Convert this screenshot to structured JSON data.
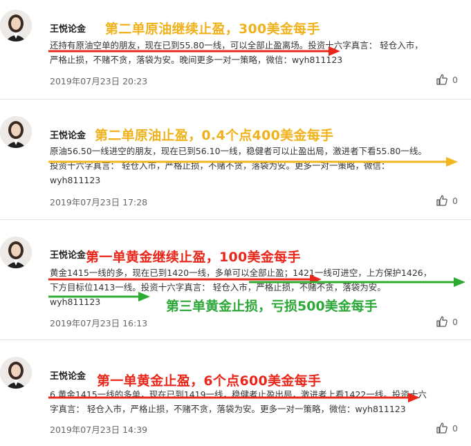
{
  "colors": {
    "yellow_headline": "#f0b21c",
    "red_headline": "#e8261a",
    "green_headline": "#2ca838",
    "red_arrow": "#e8261a",
    "yellow_arrow": "#f4b51d",
    "green_arrow": "#2caa32"
  },
  "posts": [
    {
      "author": "王悦论金",
      "headline": "第二单原油继续止盈，300美金每手",
      "lines": [
        "还持有原油空单的朋友，现在已到55.80一线，可以全部止盈离场。投资十六字真言： 轻仓入市，",
        "严格止损，不赌不贪，落袋为安。晚间更多一对一策略，微信：wyh811123"
      ],
      "date": "2019年07月23日 20:23",
      "likes": "0"
    },
    {
      "author": "王悦论金",
      "headline": "第二单原油止盈，0.4个点400美金每手",
      "lines": [
        "原油56.50一线进空的朋友，现在已到56.10一线，稳健者可以止盈出局，激进者下看55.80一线。",
        "投资十六字真言： 轻仓入市，严格止损，不赌不贪，落袋为安。更多一对一策略，微信：",
        "wyh811123"
      ],
      "date": "2019年07月23日 17:28",
      "likes": "0"
    },
    {
      "author": "王悦论金",
      "headline": "第一单黄金继续止盈，100美金每手",
      "lines": [
        "黄金1415一线的多，现在已到1420一线，多单可以全部止盈；1421一线可进空，上方保护1426，",
        "下方目标位1413一线。投资十六字真言： 轻仓入市，严格止损，不赌不贪，落袋为安。",
        "wyh811123"
      ],
      "annotation": "第三单黄金止损，亏损500美金每手",
      "date": "2019年07月23日 16:13",
      "likes": "0"
    },
    {
      "author": "王悦论金",
      "headline": "第一单黄金止盈，6个点600美金每手",
      "lines": [
        "6 黄金1415一线的多单，现在已到1419一线，稳健者止盈出局，激进者上看1422一线。投资十六",
        "字真言： 轻仓入市，严格止损，不赌不贪，落袋为安。更多一对一策略，微信：wyh811123"
      ],
      "date": "2019年07月23日 14:39",
      "likes": "0"
    }
  ]
}
